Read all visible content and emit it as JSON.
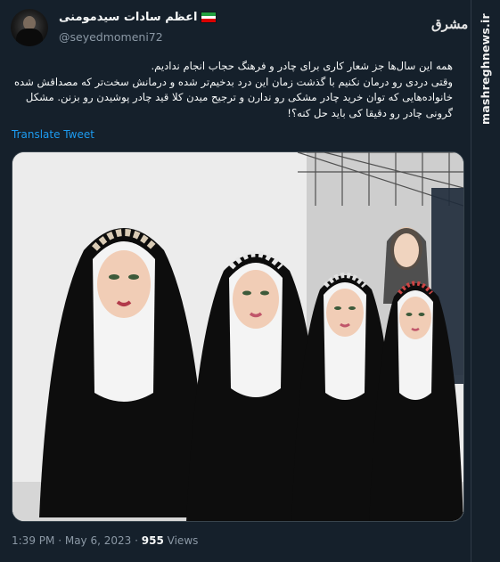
{
  "author": {
    "display_name": "اعظم سادات سیدمومنی",
    "handle": "@seyedmomeni72",
    "flag_colors": [
      "#239f40",
      "#ffffff",
      "#da0000"
    ]
  },
  "watermark": {
    "logo_text": "مشرق",
    "site": "mashreghnews.ir"
  },
  "tweet": {
    "lines": [
      "همه این سال‌ها جز شعار کاری برای چادر و فرهنگ حجاب انجام ندادیم.",
      "وقتی دردی رو درمان نکنیم با گذشت زمان این درد بدخیم‌تر شده و درمانش سخت‌تر که مصداقش شده",
      "خانواده‌هایی که توان خرید چادر مشکی رو ندارن و ترجیح میدن کلا قید چادر پوشیدن رو بزنن. مشکل",
      "گرونی چادر رو دقیقا کی باید حل کنه؟!"
    ],
    "translate_label": "Translate Tweet"
  },
  "meta": {
    "time": "1:39 PM",
    "separator": "·",
    "date": "May 6, 2023",
    "views_count": "955",
    "views_label": "Views"
  },
  "colors": {
    "background": "#15202b",
    "link": "#1d9bf0",
    "muted": "#8b98a5"
  }
}
